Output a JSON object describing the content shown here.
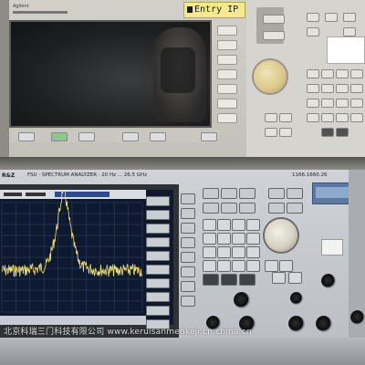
{
  "signal_generator": {
    "brand": "Agilent",
    "sticker_text": "Entry IP"
  },
  "spectrum_analyzer": {
    "logo": "R&Z",
    "title": "FSU  ·  SPECTRUM ANALYZER  ·  20 Hz ... 26.5 GHz",
    "serial": "1166.1660.26",
    "display": {
      "trace_color": "#f2e36b",
      "peak_position_fraction": 0.5,
      "noise_floor_fraction": 0.62
    }
  },
  "watermark": "北京科瑞三门科技有限公司    www.keruisanmenkeji.cn.china.cn"
}
